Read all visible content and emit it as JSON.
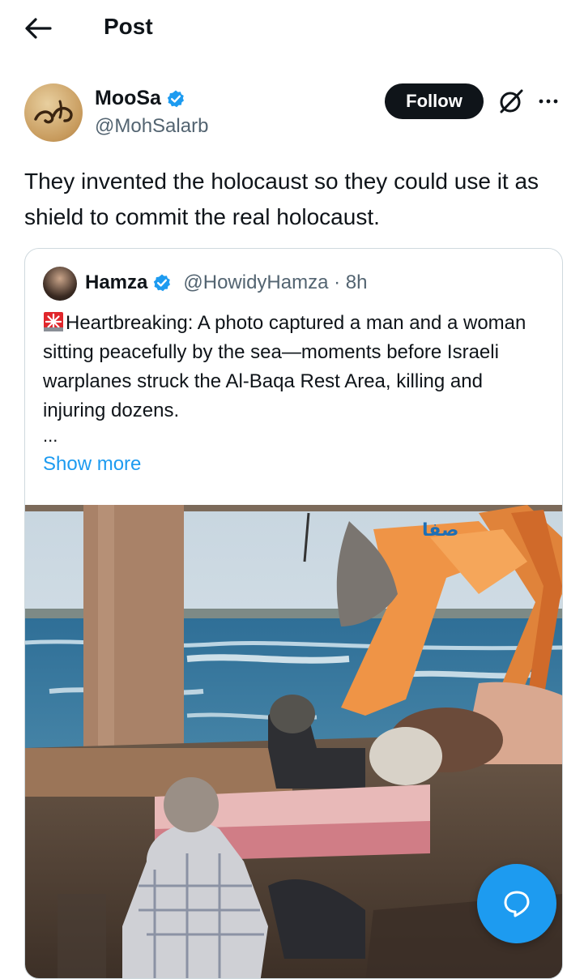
{
  "header": {
    "title": "Post"
  },
  "author": {
    "name": "MooSa",
    "handle": "@MohSalarb",
    "follow_label": "Follow"
  },
  "post": {
    "text": "They invented the holocaust so they could use it as shield to commit the real holocaust."
  },
  "quoted": {
    "name": "Hamza",
    "handle_time": "@HowidyHamza · 8h",
    "text": "Heartbreaking: A photo captured a man and a woman sitting peacefully by the sea—moments before Israeli warplanes struck the Al-Baqa Rest Area, killing and injuring dozens.",
    "ellipsis": "...",
    "show_more": "Show more",
    "media_watermark": "صفا"
  },
  "colors": {
    "accent": "#1d9bf0",
    "text": "#0f1419",
    "muted": "#536471",
    "border": "#cfd9de"
  }
}
